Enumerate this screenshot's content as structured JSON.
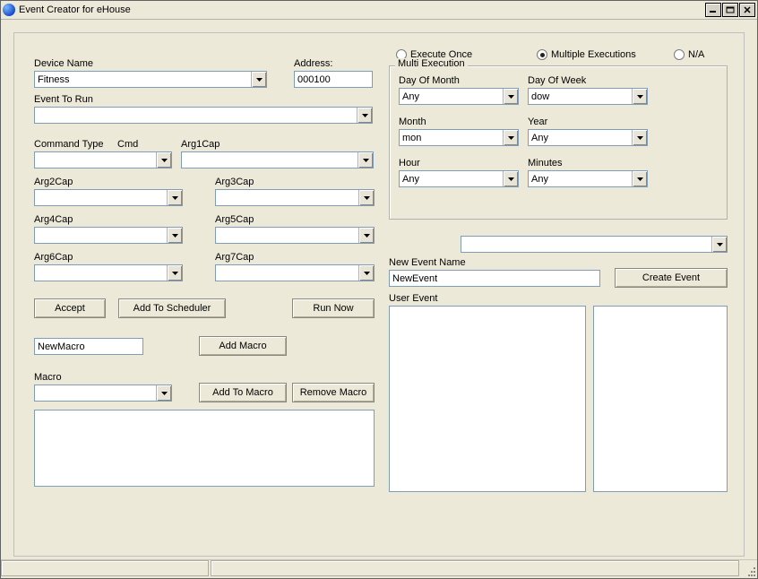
{
  "window": {
    "title": "Event Creator for eHouse"
  },
  "labels": {
    "device_name": "Device Name",
    "address": "Address:",
    "event_to_run": "Event To Run",
    "command_type": "Command Type",
    "cmd": "Cmd",
    "arg1": "Arg1Cap",
    "arg2": "Arg2Cap",
    "arg3": "Arg3Cap",
    "arg4": "Arg4Cap",
    "arg5": "Arg5Cap",
    "arg6": "Arg6Cap",
    "arg7": "Arg7Cap",
    "macro": "Macro",
    "new_event_name": "New Event Name",
    "user_event": "User Event"
  },
  "fields": {
    "device_name": "Fitness",
    "address": "000100",
    "event_to_run": "",
    "new_event_name": "NewEvent",
    "new_macro_name": "NewMacro"
  },
  "execution": {
    "group_label": "Multi Execution",
    "mode_once": "Execute Once",
    "mode_multi": "Multiple Executions",
    "mode_na": "N/A",
    "selected_mode": "multi",
    "dom_label": "Day Of Month",
    "dom_value": "Any",
    "dow_label": "Day Of Week",
    "dow_value": "dow",
    "month_label": "Month",
    "month_value": "mon",
    "year_label": "Year",
    "year_value": "Any",
    "hour_label": "Hour",
    "hour_value": "Any",
    "minutes_label": "Minutes",
    "minutes_value": "Any"
  },
  "buttons": {
    "accept": "Accept",
    "add_scheduler": "Add To Scheduler",
    "run_now": "Run Now",
    "add_macro": "Add Macro",
    "add_to_macro": "Add To Macro",
    "remove_macro": "Remove Macro",
    "create_event": "Create Event"
  }
}
